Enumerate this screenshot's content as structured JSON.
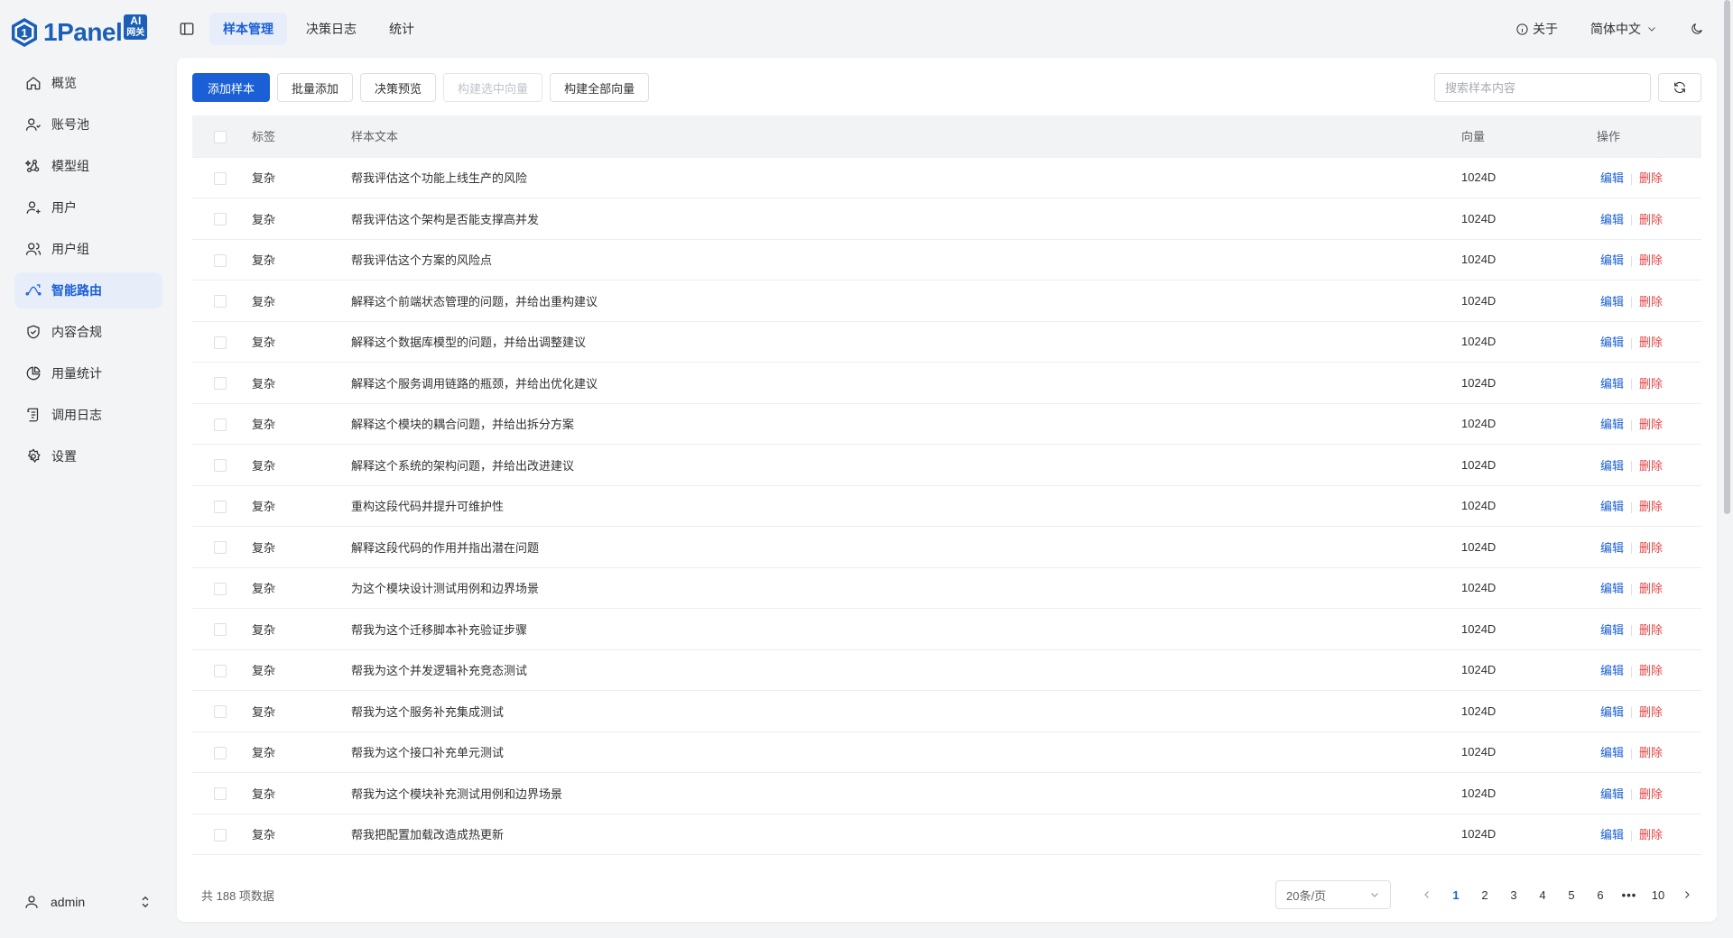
{
  "brand": {
    "name": "1Panel",
    "badge_top": "AI",
    "badge_bottom": "网关"
  },
  "sidebar": {
    "items": [
      {
        "label": "概览",
        "icon": "home-icon"
      },
      {
        "label": "账号池",
        "icon": "account-pool-icon"
      },
      {
        "label": "模型组",
        "icon": "model-group-icon"
      },
      {
        "label": "用户",
        "icon": "user-icon"
      },
      {
        "label": "用户组",
        "icon": "user-group-icon"
      },
      {
        "label": "智能路由",
        "icon": "route-icon",
        "active": true
      },
      {
        "label": "内容合规",
        "icon": "shield-check-icon"
      },
      {
        "label": "用量统计",
        "icon": "pie-chart-icon"
      },
      {
        "label": "调用日志",
        "icon": "log-scroll-icon"
      },
      {
        "label": "设置",
        "icon": "gear-icon"
      }
    ],
    "user": {
      "name": "admin"
    }
  },
  "header": {
    "tabs": [
      {
        "label": "样本管理",
        "active": true
      },
      {
        "label": "决策日志"
      },
      {
        "label": "统计"
      }
    ],
    "about": "关于",
    "language": "简体中文"
  },
  "toolbar": {
    "add_sample": "添加样本",
    "batch_add": "批量添加",
    "decision_preview": "决策预览",
    "build_selected": "构建选中向量",
    "build_all": "构建全部向量",
    "search_placeholder": "搜索样本内容"
  },
  "table": {
    "headers": {
      "tag": "标签",
      "text": "样本文本",
      "vector": "向量",
      "action": "操作"
    },
    "edit_label": "编辑",
    "delete_label": "删除",
    "rows": [
      {
        "tag": "复杂",
        "text": "帮我评估这个功能上线生产的风险",
        "vector": "1024D"
      },
      {
        "tag": "复杂",
        "text": "帮我评估这个架构是否能支撑高并发",
        "vector": "1024D"
      },
      {
        "tag": "复杂",
        "text": "帮我评估这个方案的风险点",
        "vector": "1024D"
      },
      {
        "tag": "复杂",
        "text": "解释这个前端状态管理的问题，并给出重构建议",
        "vector": "1024D"
      },
      {
        "tag": "复杂",
        "text": "解释这个数据库模型的问题，并给出调整建议",
        "vector": "1024D"
      },
      {
        "tag": "复杂",
        "text": "解释这个服务调用链路的瓶颈，并给出优化建议",
        "vector": "1024D"
      },
      {
        "tag": "复杂",
        "text": "解释这个模块的耦合问题，并给出拆分方案",
        "vector": "1024D"
      },
      {
        "tag": "复杂",
        "text": "解释这个系统的架构问题，并给出改进建议",
        "vector": "1024D"
      },
      {
        "tag": "复杂",
        "text": "重构这段代码并提升可维护性",
        "vector": "1024D"
      },
      {
        "tag": "复杂",
        "text": "解释这段代码的作用并指出潜在问题",
        "vector": "1024D"
      },
      {
        "tag": "复杂",
        "text": "为这个模块设计测试用例和边界场景",
        "vector": "1024D"
      },
      {
        "tag": "复杂",
        "text": "帮我为这个迁移脚本补充验证步骤",
        "vector": "1024D"
      },
      {
        "tag": "复杂",
        "text": "帮我为这个并发逻辑补充竞态测试",
        "vector": "1024D"
      },
      {
        "tag": "复杂",
        "text": "帮我为这个服务补充集成测试",
        "vector": "1024D"
      },
      {
        "tag": "复杂",
        "text": "帮我为这个接口补充单元测试",
        "vector": "1024D"
      },
      {
        "tag": "复杂",
        "text": "帮我为这个模块补充测试用例和边界场景",
        "vector": "1024D"
      },
      {
        "tag": "复杂",
        "text": "帮我把配置加载改造成热更新",
        "vector": "1024D"
      }
    ]
  },
  "pagination": {
    "total_text": "共 188 项数据",
    "page_size": "20条/页",
    "pages": [
      "1",
      "2",
      "3",
      "4",
      "5",
      "6",
      "•••",
      "10"
    ],
    "current": "1"
  },
  "colors": {
    "primary": "#1a5fd6",
    "danger": "#e54545",
    "brand": "#1b5fb7"
  }
}
